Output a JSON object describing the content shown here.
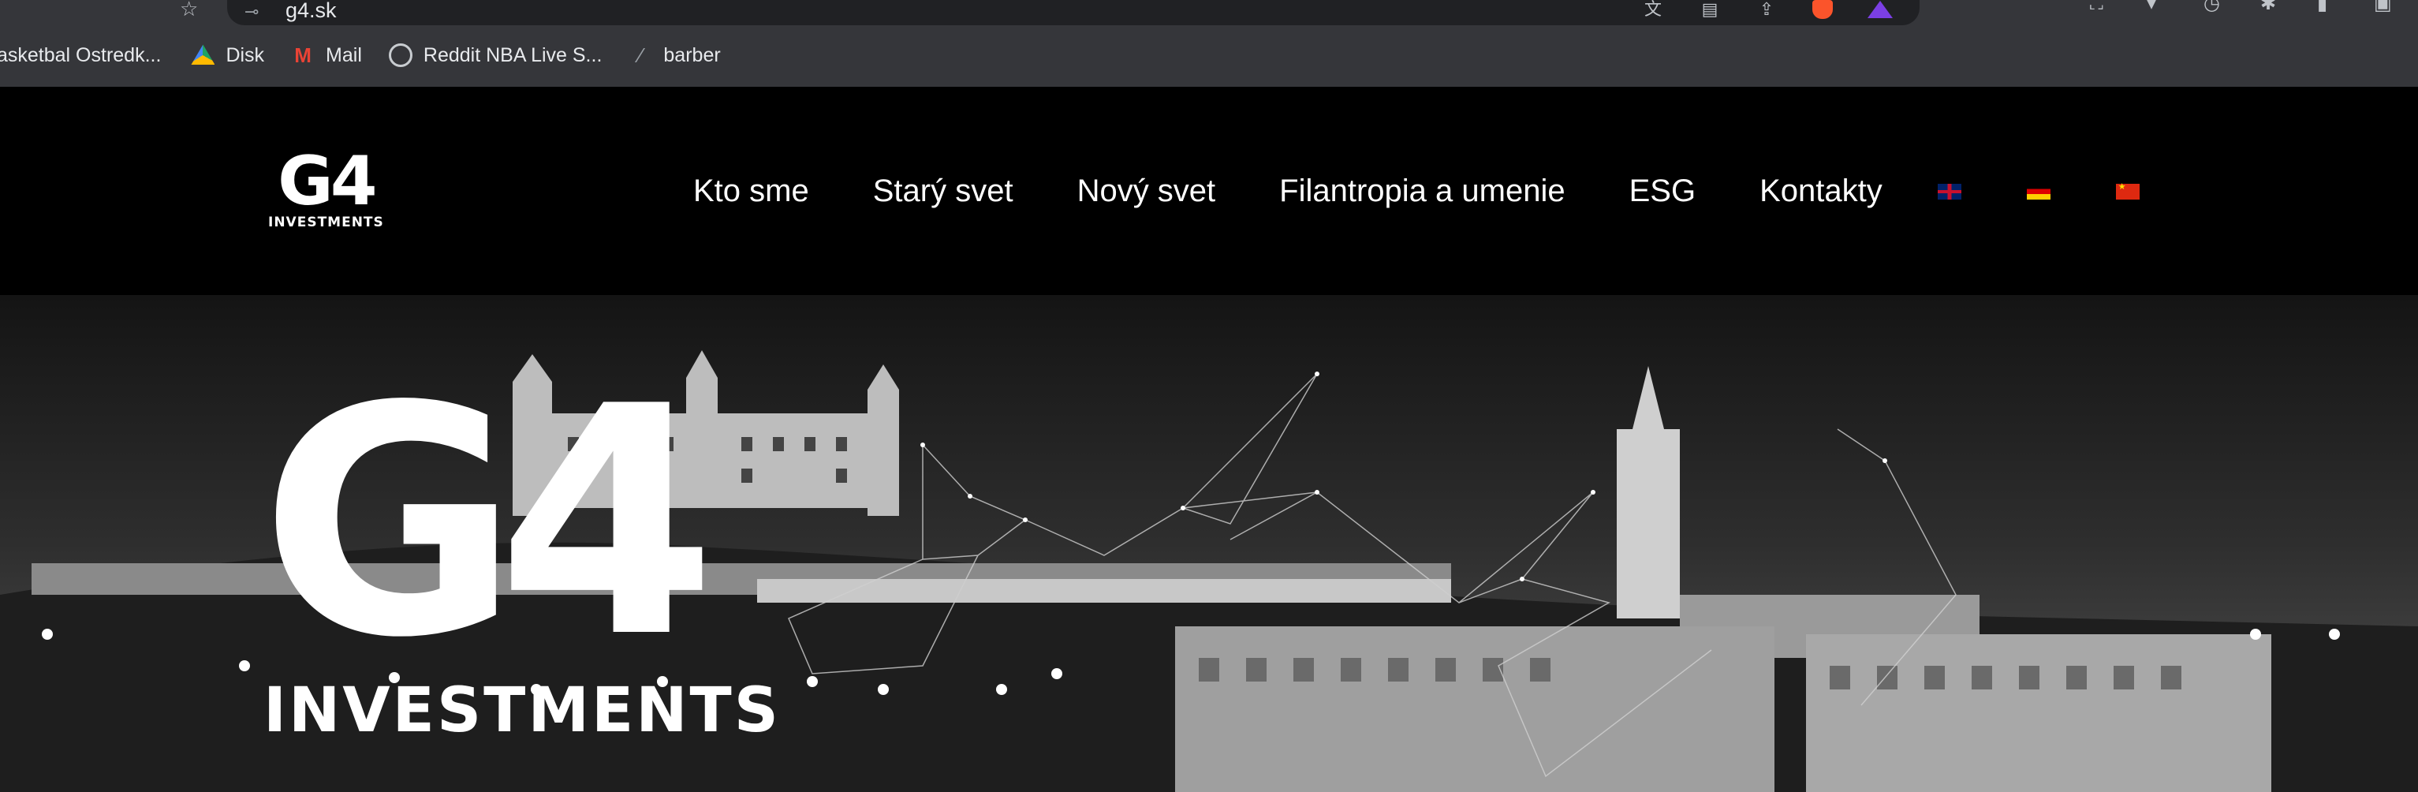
{
  "browser": {
    "url": "g4.sk",
    "bookmarks": [
      {
        "label": "asketbal Ostredk...",
        "icon": "generic-icon"
      },
      {
        "label": "Disk",
        "icon": "google-drive-icon"
      },
      {
        "label": "Mail",
        "icon": "gmail-icon"
      },
      {
        "label": "Reddit NBA Live S...",
        "icon": "globe-icon"
      },
      {
        "label": "barber",
        "icon": "feather-icon"
      }
    ]
  },
  "site": {
    "logo_mark": "G4",
    "logo_sub": "INVESTMENTS",
    "nav": [
      "Kto sme",
      "Starý svet",
      "Nový svet",
      "Filantropia a umenie",
      "ESG",
      "Kontakty"
    ],
    "languages": [
      "English",
      "Deutsch",
      "中文"
    ]
  },
  "hero": {
    "logo_mark": "G4",
    "logo_sub": "INVESTMENTS"
  }
}
